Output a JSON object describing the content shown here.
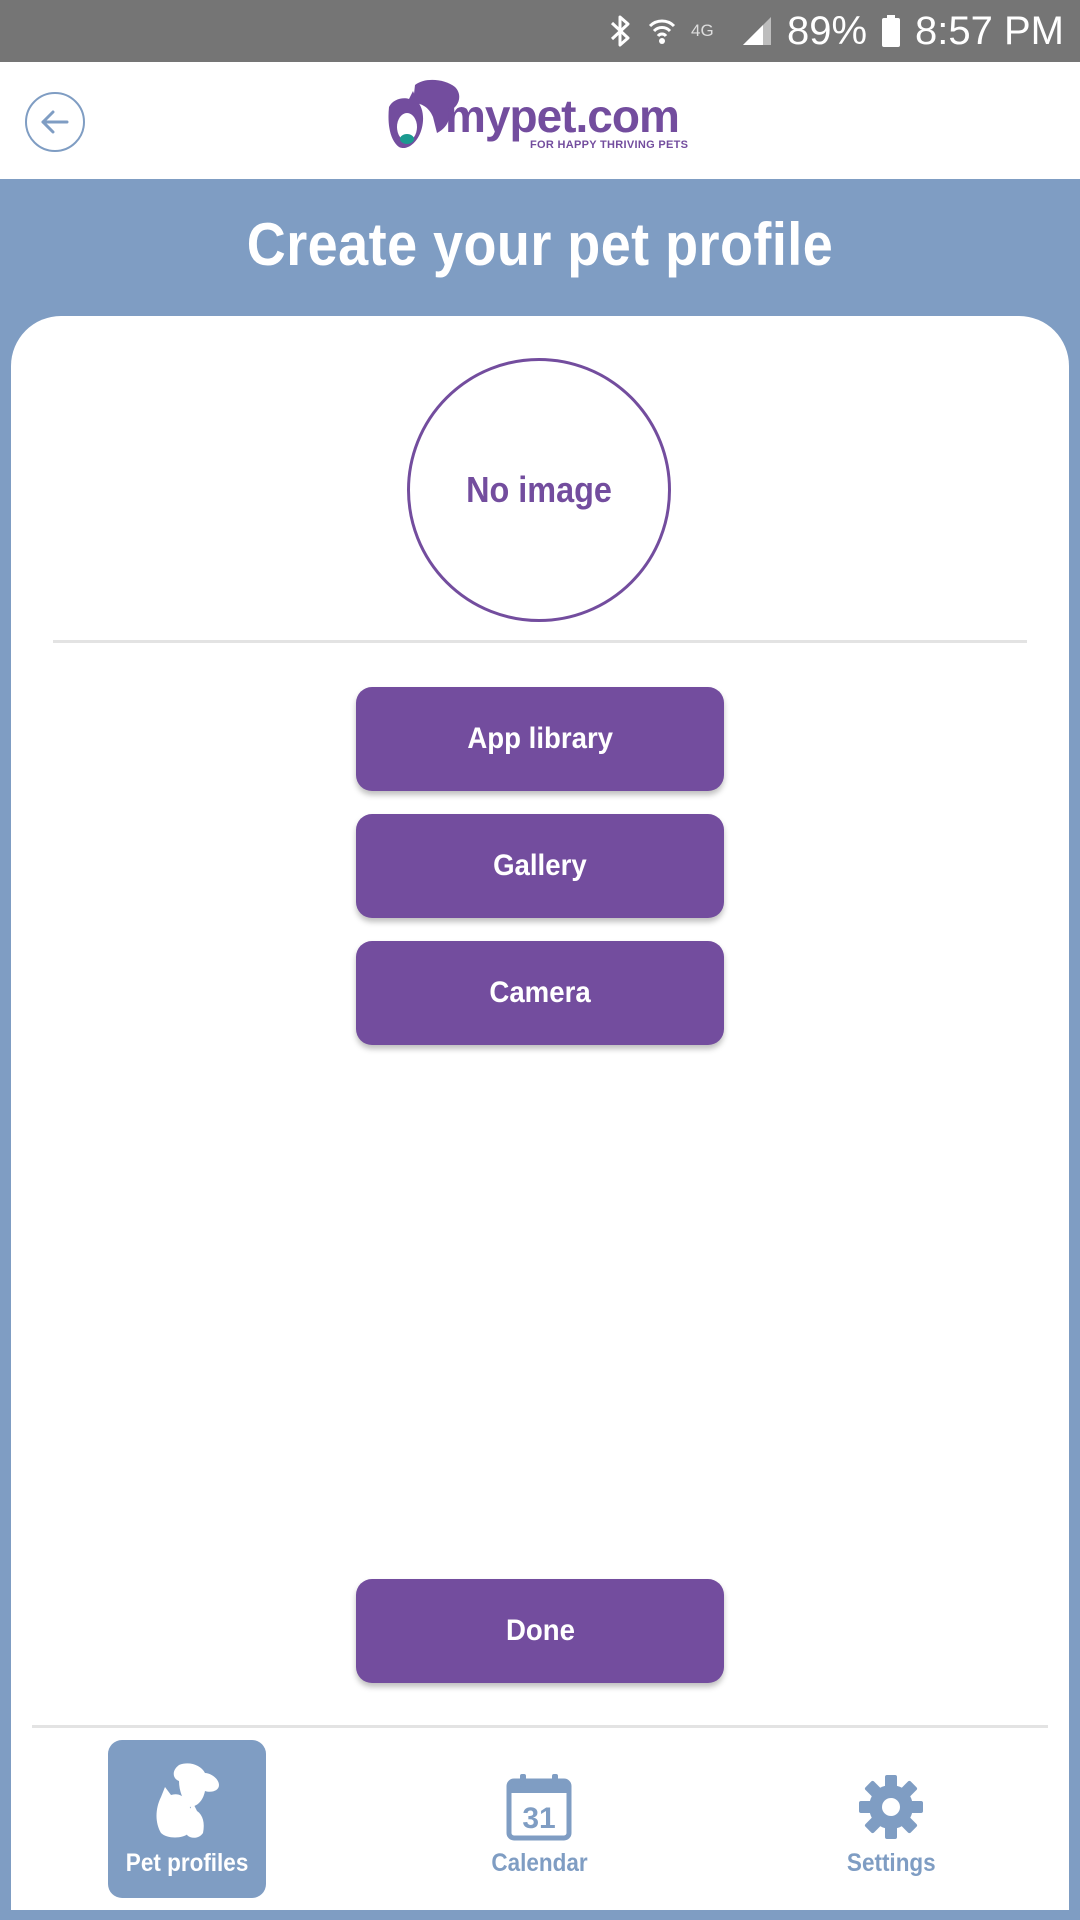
{
  "status_bar": {
    "battery_percent": "89%",
    "time": "8:57 PM",
    "network": "4G",
    "icons": [
      "bluetooth-icon",
      "wifi-icon",
      "network-4g-icon",
      "signal-icon",
      "battery-icon"
    ]
  },
  "header": {
    "logo_text": "mypet.com",
    "logo_tagline": "FOR HAPPY THRIVING PETS",
    "back_icon": "back-arrow-icon"
  },
  "page": {
    "title": "Create your pet profile"
  },
  "profile_image": {
    "placeholder": "No image"
  },
  "image_sources": {
    "app_library": "App library",
    "gallery": "Gallery",
    "camera": "Camera"
  },
  "actions": {
    "done": "Done"
  },
  "bottom_nav": {
    "items": [
      {
        "label": "Pet profiles",
        "icon": "pets-icon",
        "active": true
      },
      {
        "label": "Calendar",
        "icon": "calendar-icon",
        "calendar_day": "31",
        "active": false
      },
      {
        "label": "Settings",
        "icon": "gear-icon",
        "active": false
      }
    ]
  },
  "colors": {
    "primary_purple": "#734d9e",
    "accent_blue": "#7f9dc3",
    "status_bar": "#757575",
    "background_white": "#ffffff"
  }
}
